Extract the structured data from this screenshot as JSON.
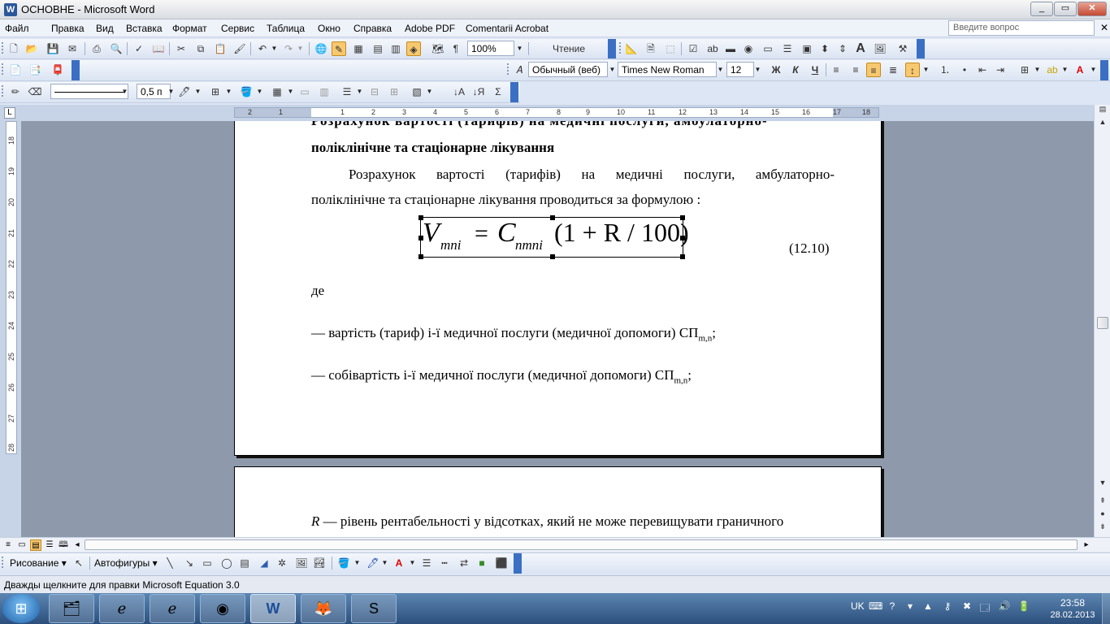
{
  "window": {
    "title": "ОСНОВНЕ - Microsoft Word",
    "min": "_",
    "max": "▭",
    "close": "✕"
  },
  "menu": [
    "Файл",
    "Правка",
    "Вид",
    "Вставка",
    "Формат",
    "Сервис",
    "Таблица",
    "Окно",
    "Справка",
    "Adobe PDF",
    "Comentarii Acrobat"
  ],
  "help": {
    "placeholder": "Введите вопрос"
  },
  "toolbar": {
    "zoom": "100%",
    "reading": "Чтение",
    "style": "Обычный (веб)",
    "font": "Times New Roman",
    "size": "12",
    "bold": "Ж",
    "italic": "К",
    "underline": "Ч",
    "line_width": "0,5 п"
  },
  "ruler": {
    "h_numbers": [
      "2",
      "1",
      "1",
      "2",
      "3",
      "4",
      "5",
      "6",
      "7",
      "8",
      "9",
      "10",
      "11",
      "12",
      "13",
      "14",
      "15",
      "16",
      "17",
      "18"
    ],
    "v_numbers": [
      "18",
      "19",
      "20",
      "21",
      "22",
      "23",
      "24",
      "25",
      "26",
      "27",
      "28"
    ]
  },
  "document": {
    "heading_top": "Розрахунок вартості (тарифів) на медичні послуги, амбулаторно-",
    "heading_bottom": "поліклінічне та стаціонарне лікування",
    "para_line1": "Розрахунок вартості (тарифів) на медичні послуги, амбулаторно-",
    "para_line2": "поліклінічне та стаціонарне лікування проводиться за формулою :",
    "equation": {
      "v": "V",
      "v_sub": "mni",
      "equals": "=",
      "c": "C",
      "c_sub": "nmni",
      "rest": "(1 + R / 100)"
    },
    "eq_number": "(12.10)",
    "de": "де",
    "item1": "— вартість (тариф) і-ї медичної послуги (медичної допомоги) СП",
    "item1_sub": "m,n",
    "item1_end": ";",
    "item2": "— собівартість і-ї медичної послуги (медичної допомоги) СП",
    "item2_sub": "m,n",
    "item2_end": ";",
    "page2_r": "R",
    "page2_text": " — рівень рентабельності у відсотках, який не може перевищувати граничного"
  },
  "drawing": {
    "draw": "Рисование",
    "autoshapes": "Автофигуры"
  },
  "status": {
    "text": "Дважды щелкните для правки Microsoft Equation 3.0"
  },
  "taskbar": {
    "lang": "UK",
    "time": "23:58",
    "date": "28.02.2013"
  }
}
